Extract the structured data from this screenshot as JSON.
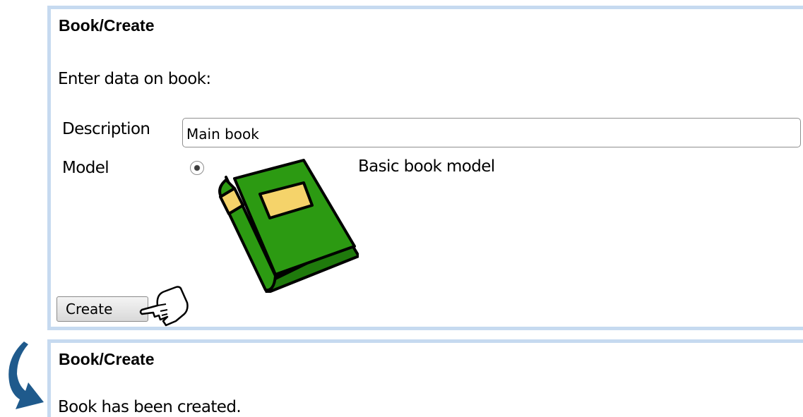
{
  "colors": {
    "panel_border": "#c6daf0",
    "book_cover": "#2c9a12",
    "book_label": "#f5d36a",
    "arrow": "#1f5a8c"
  },
  "form_panel": {
    "title": "Book/Create",
    "intro": "Enter data on book:",
    "description": {
      "label": "Description",
      "value": "Main book"
    },
    "model": {
      "label": "Model",
      "selected": true,
      "icon": "book-icon",
      "option_label": "Basic book model"
    },
    "create_button": {
      "label": "Create",
      "cursor_icon": "pointer-hand-icon"
    }
  },
  "transition_icon": "curved-arrow-icon",
  "result_panel": {
    "title": "Book/Create",
    "message": "Book has been created."
  }
}
